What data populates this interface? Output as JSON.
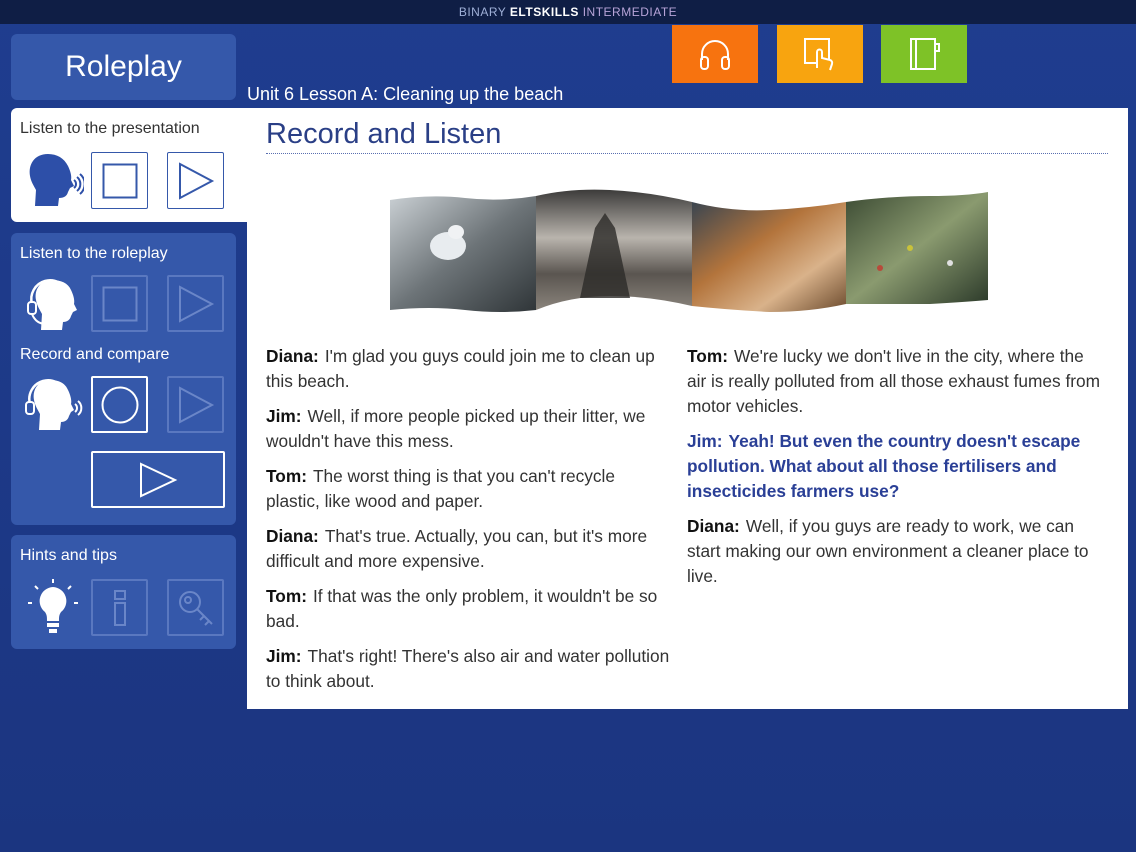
{
  "app": {
    "brand_part1": "BINARY ",
    "brand_part2": "ELTSKILLS",
    "brand_part3": " INTERMEDIATE"
  },
  "header": {
    "section_title": "Roleplay",
    "lesson_title": "Unit 6 Lesson A: Cleaning up the beach",
    "buttons": [
      {
        "icon": "headphones-icon",
        "color": "#f7730f"
      },
      {
        "icon": "touch-icon",
        "color": "#f8a40f"
      },
      {
        "icon": "notebook-icon",
        "color": "#7ec227"
      }
    ]
  },
  "sidebar": {
    "presentation_label": "Listen to the presentation",
    "roleplay_label": "Listen to the roleplay",
    "compare_label": "Record and compare",
    "hints_label": "Hints and tips"
  },
  "content": {
    "title": "Record and Listen",
    "dialogue_left": [
      {
        "speaker": "Diana:",
        "text": "I'm glad you guys could join me to clean up this beach.",
        "highlight": false
      },
      {
        "speaker": "Jim:",
        "text": "Well, if more people picked up their litter, we wouldn't have this mess.",
        "highlight": false
      },
      {
        "speaker": "Tom:",
        "text": "The worst thing is that you can't recycle plastic, like wood and paper.",
        "highlight": false
      },
      {
        "speaker": "Diana:",
        "text": "That's true. Actually, you can, but it's more difficult and more expensive.",
        "highlight": false
      },
      {
        "speaker": "Tom:",
        "text": "If that was the only problem, it wouldn't be so bad.",
        "highlight": false
      },
      {
        "speaker": "Jim:",
        "text": "That's right! There's also air and water pollution to think about.",
        "highlight": false
      }
    ],
    "dialogue_right": [
      {
        "speaker": "Tom:",
        "text": "We're lucky we don't live in the city, where the air is really polluted from all those exhaust fumes from motor vehicles.",
        "highlight": false
      },
      {
        "speaker": "Jim:",
        "text": "Yeah! But even the country doesn't escape pollution. What about all those fertilisers and insecticides farmers use?",
        "highlight": true
      },
      {
        "speaker": "Diana:",
        "text": "Well, if you guys are ready to work, we can start making our own environment a cleaner place to live.",
        "highlight": false
      }
    ]
  }
}
